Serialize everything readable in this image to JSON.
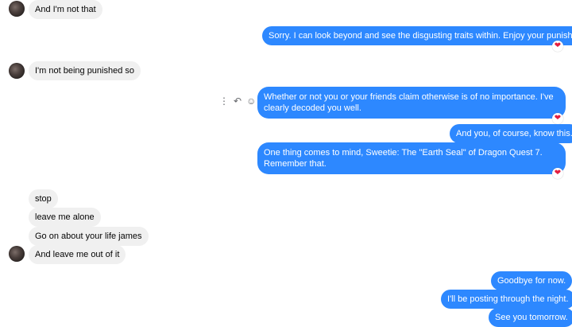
{
  "messages": [
    {
      "text": "And I'm not that"
    },
    {
      "text": "Sorry. I can look beyond and see the disgusting traits within. Enjoy your punishment."
    },
    {
      "text": "I'm not being punished so"
    },
    {
      "text": "Whether or not you or your friends claim otherwise is of no importance. I've clearly decoded you well."
    },
    {
      "text": "And you, of course, know this."
    },
    {
      "text": "One thing comes to mind, Sweetie: The \"Earth Seal\" of Dragon Quest 7. Remember that."
    },
    {
      "text": "stop"
    },
    {
      "text": "leave me alone"
    },
    {
      "text": "Go on about your life james"
    },
    {
      "text": "And leave me out of it"
    },
    {
      "text": "Goodbye for now."
    },
    {
      "text": "I'll be posting through the night."
    },
    {
      "text": "See you tomorrow."
    }
  ],
  "reaction": {
    "icon": "heart-icon",
    "glyph": "❤",
    "color": "#e41e3f"
  },
  "message_actions": {
    "more_glyph": "⋮",
    "reply_glyph": "↶",
    "emoji_glyph": "☺"
  },
  "colors": {
    "outgoing_bubble": "#2d88ff",
    "incoming_bubble": "#f0f0f0"
  }
}
